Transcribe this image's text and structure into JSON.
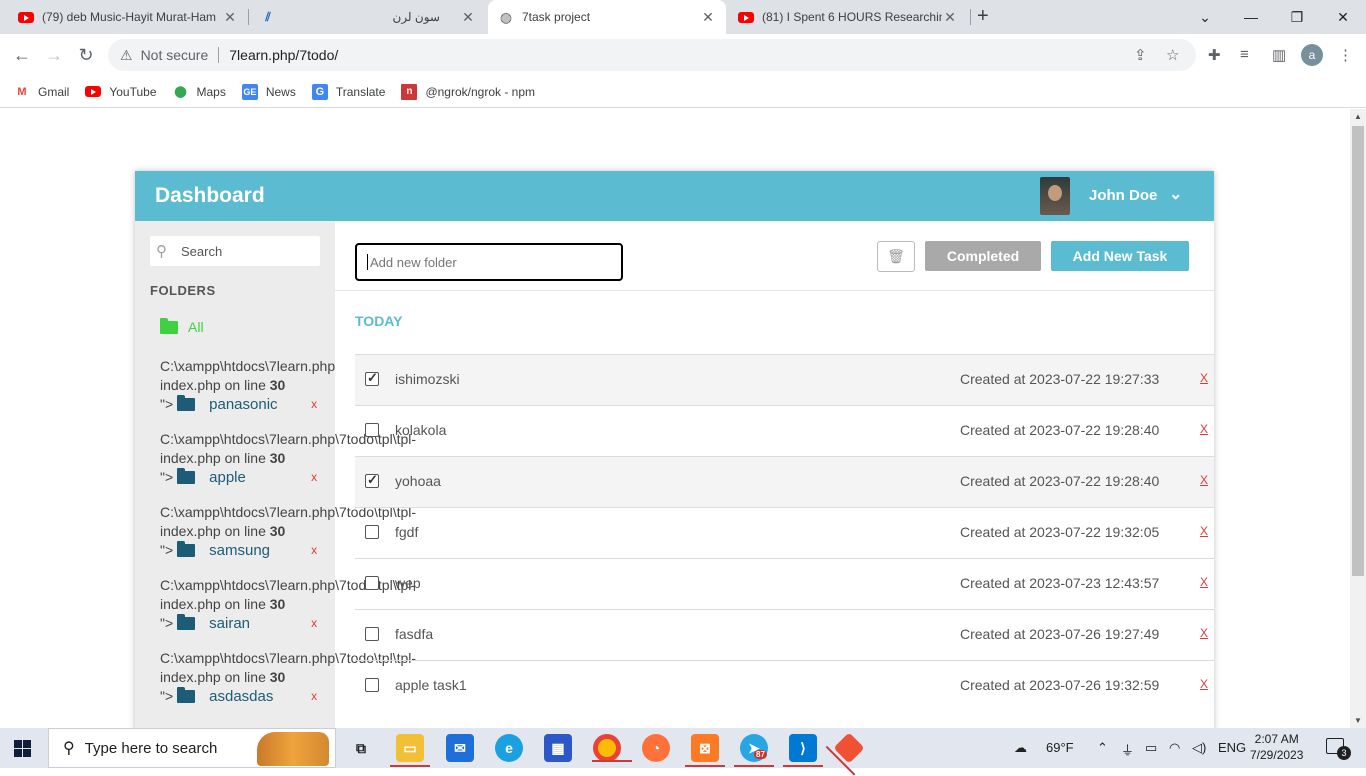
{
  "browser": {
    "tabs": [
      {
        "title": "(79) deb Music-Hayit Murat-Ham",
        "icon": "youtube-icon",
        "active": false
      },
      {
        "title": "سون لرن",
        "icon": "sevenlearn-icon",
        "active": false
      },
      {
        "title": "7task project",
        "icon": "globe-icon",
        "active": true
      },
      {
        "title": "(81) I Spent 6 HOURS Researchin",
        "icon": "youtube-icon",
        "active": false
      }
    ],
    "address": {
      "security": "Not secure",
      "url": "7learn.php/7todo/"
    },
    "profile_initial": "a",
    "bookmarks": [
      {
        "label": "Gmail",
        "icon": "gmail-icon"
      },
      {
        "label": "YouTube",
        "icon": "youtube-icon"
      },
      {
        "label": "Maps",
        "icon": "maps-icon"
      },
      {
        "label": "News",
        "icon": "news-icon"
      },
      {
        "label": "Translate",
        "icon": "translate-icon"
      },
      {
        "label": "@ngrok/ngrok - npm",
        "icon": "npm-icon"
      }
    ]
  },
  "dashboard": {
    "title": "Dashboard",
    "user": {
      "name": "John Doe"
    },
    "search_placeholder": "Search",
    "folders_heading": "FOLDERS",
    "all_label": "All",
    "folders": [
      {
        "error_path": "C:\\xampp\\htdocs\\7learn.php",
        "error_line": "index.php on line",
        "line_no": "30",
        "prefix": "\">",
        "name": "panasonic",
        "delete": "x"
      },
      {
        "error_path": "C:\\xampp\\htdocs\\7learn.php\\7todo\\tpl\\tpl-",
        "error_line": "index.php on line",
        "line_no": "30",
        "prefix": "\">",
        "name": "apple",
        "delete": "x"
      },
      {
        "error_path": "C:\\xampp\\htdocs\\7learn.php\\7todo\\tpl\\tpl-",
        "error_line": "index.php on line",
        "line_no": "30",
        "prefix": "\">",
        "name": "samsung",
        "delete": "x"
      },
      {
        "error_path": "C:\\xampp\\htdocs\\7learn.php\\7todo\\tpl\\tpl-",
        "error_line": "index.php on line",
        "line_no": "30",
        "prefix": "\">",
        "name": "sairan",
        "delete": "x"
      },
      {
        "error_path": "C:\\xampp\\htdocs\\7learn.php\\7todo\\tpl\\tpl-",
        "error_line": "index.php on line",
        "line_no": "30",
        "prefix": "\">",
        "name": "asdasdas",
        "delete": "x"
      }
    ],
    "new_folder_placeholder": "Add new folder",
    "completed_label": "Completed",
    "add_task_label": "Add New Task",
    "today_heading": "TODAY",
    "tasks": [
      {
        "name": "ishimozski",
        "created": "Created at 2023-07-22 19:27:33",
        "done": true,
        "delete": "X"
      },
      {
        "name": "kolakola",
        "created": "Created at 2023-07-22 19:28:40",
        "done": false,
        "delete": "X"
      },
      {
        "name": "yohoaa",
        "created": "Created at 2023-07-22 19:28:40",
        "done": true,
        "delete": "X"
      },
      {
        "name": "fgdf",
        "created": "Created at 2023-07-22 19:32:05",
        "done": false,
        "delete": "X"
      },
      {
        "name": "wep",
        "created": "Created at 2023-07-23 12:43:57",
        "done": false,
        "delete": "X"
      },
      {
        "name": "fasdfa",
        "created": "Created at 2023-07-26 19:27:49",
        "done": false,
        "delete": "X"
      },
      {
        "name": "apple task1",
        "created": "Created at 2023-07-26 19:32:59",
        "done": false,
        "delete": "X"
      }
    ],
    "colors": {
      "header": "#5bbbd1",
      "sidebar": "#ececec",
      "all_folder": "#3fd13f",
      "folder": "#1c5c76",
      "delete": "#e53935"
    }
  },
  "taskbar": {
    "search_placeholder": "Type here to search",
    "weather": "69°F",
    "language": "ENG",
    "time": "2:07 AM",
    "date": "7/29/2023",
    "notification_count": "3",
    "telegram_badge": "87"
  }
}
